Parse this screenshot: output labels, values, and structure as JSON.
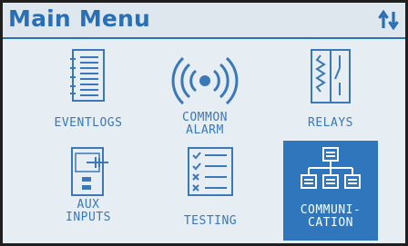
{
  "header": {
    "title": "Main Menu",
    "nav_icon": "up-down-arrows-icon"
  },
  "menu": {
    "items": [
      {
        "id": "eventlogs",
        "line1": "EVENTLOGS",
        "line2": "",
        "icon": "event-log-list-icon",
        "selected": false
      },
      {
        "id": "common-alarm",
        "line1": "COMMON",
        "line2": "ALARM",
        "icon": "alarm-broadcast-icon",
        "selected": false
      },
      {
        "id": "relays",
        "line1": "RELAYS",
        "line2": "",
        "icon": "relay-switch-icon",
        "selected": false
      },
      {
        "id": "aux-inputs",
        "line1": "AUX",
        "line2": "INPUTS",
        "icon": "aux-input-device-icon",
        "selected": false
      },
      {
        "id": "testing",
        "line1": "TESTING",
        "line2": "",
        "icon": "test-checklist-icon",
        "selected": false
      },
      {
        "id": "communication",
        "line1": "COMMUNI-",
        "line2": "CATION",
        "icon": "network-hierarchy-icon",
        "selected": true
      }
    ]
  },
  "colors": {
    "accent": "#2a6fb3",
    "screen_bg": "#e6edf3",
    "selected_bg": "#2f76bd"
  }
}
